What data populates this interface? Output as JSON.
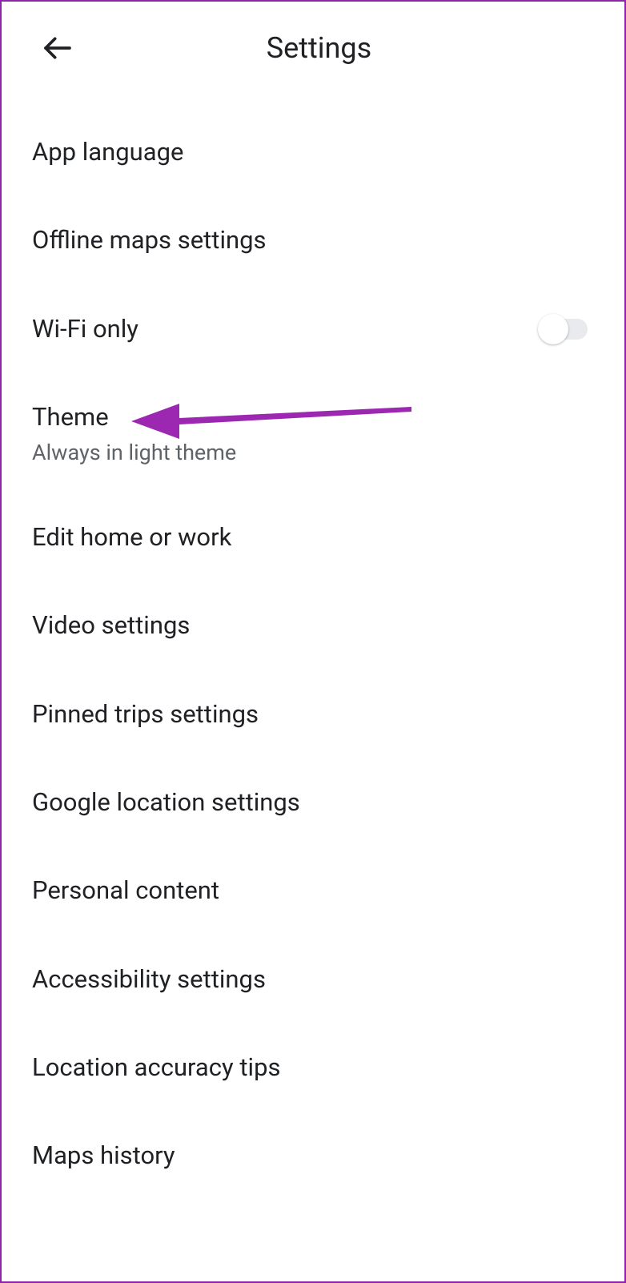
{
  "header": {
    "title": "Settings"
  },
  "items": [
    {
      "title": "App language"
    },
    {
      "title": "Offline maps settings"
    },
    {
      "title": "Wi-Fi only",
      "toggle": false
    },
    {
      "title": "Theme",
      "subtitle": "Always in light theme"
    },
    {
      "title": "Edit home or work"
    },
    {
      "title": "Video settings"
    },
    {
      "title": "Pinned trips settings"
    },
    {
      "title": "Google location settings"
    },
    {
      "title": "Personal content"
    },
    {
      "title": "Accessibility settings"
    },
    {
      "title": "Location accuracy tips"
    },
    {
      "title": "Maps history"
    }
  ],
  "annotation": {
    "color": "#9c27b0",
    "target": "theme"
  }
}
